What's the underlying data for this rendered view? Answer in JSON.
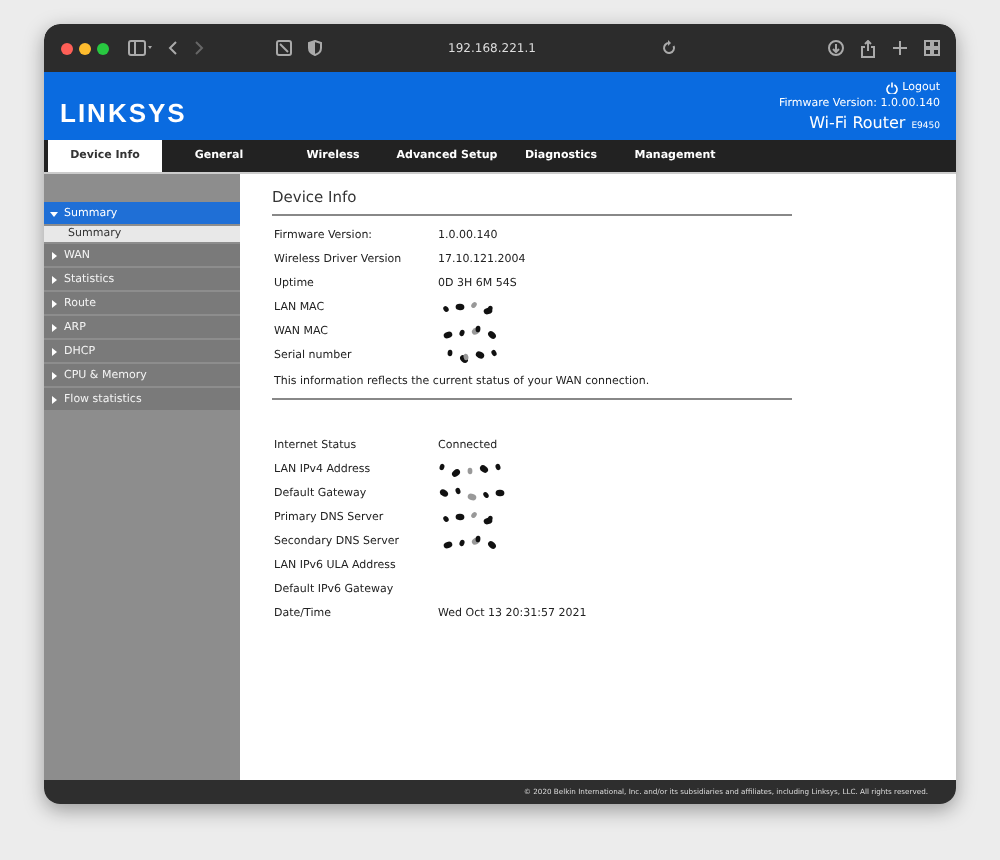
{
  "browser": {
    "address": "192.168.221.1"
  },
  "header": {
    "logo": "LINKSYS",
    "logout": "Logout",
    "firmware": "Firmware Version: 1.0.00.140",
    "product": "Wi-Fi Router",
    "model": "E9450"
  },
  "tabs": [
    {
      "label": "Device Info",
      "selected": true
    },
    {
      "label": "General",
      "selected": false
    },
    {
      "label": "Wireless",
      "selected": false
    },
    {
      "label": "Advanced Setup",
      "selected": false
    },
    {
      "label": "Diagnostics",
      "selected": false
    },
    {
      "label": "Management",
      "selected": false
    }
  ],
  "sidebar": {
    "items": [
      {
        "label": "Summary",
        "expanded": true,
        "selected": true,
        "children": [
          {
            "label": "Summary",
            "selected": false
          }
        ]
      },
      {
        "label": "WAN",
        "expanded": false,
        "selected": false
      },
      {
        "label": "Statistics",
        "expanded": false,
        "selected": false
      },
      {
        "label": "Route",
        "expanded": false,
        "selected": false
      },
      {
        "label": "ARP",
        "expanded": false,
        "selected": false
      },
      {
        "label": "DHCP",
        "expanded": false,
        "selected": false
      },
      {
        "label": "CPU & Memory",
        "expanded": false,
        "selected": false
      },
      {
        "label": "Flow statistics",
        "expanded": false,
        "selected": false
      }
    ]
  },
  "content": {
    "title": "Device Info",
    "device_rows": [
      {
        "label": "Firmware Version:",
        "value": "1.0.00.140"
      },
      {
        "label": "Wireless Driver Version",
        "value": "17.10.121.2004"
      },
      {
        "label": "Uptime",
        "value": "0D 3H 6M 54S"
      },
      {
        "label": "LAN MAC",
        "redacted": true
      },
      {
        "label": "WAN MAC",
        "redacted": true
      },
      {
        "label": "Serial number",
        "redacted": true
      }
    ],
    "note": "This information reflects the current status of your WAN connection.",
    "status_rows": [
      {
        "label": "Internet Status",
        "value": "Connected"
      },
      {
        "label": "LAN IPv4 Address",
        "redacted": true
      },
      {
        "label": "Default Gateway",
        "redacted": true
      },
      {
        "label": "Primary DNS Server",
        "redacted": true
      },
      {
        "label": "Secondary DNS Server",
        "redacted": true
      },
      {
        "label": "LAN IPv6 ULA Address"
      },
      {
        "label": "Default IPv6 Gateway"
      },
      {
        "label": "Date/Time",
        "value": "Wed Oct 13 20:31:57 2021"
      }
    ]
  },
  "footer": "© 2020 Belkin International, Inc. and/or its subsidiaries and affiliates, including Linksys, LLC. All rights reserved."
}
